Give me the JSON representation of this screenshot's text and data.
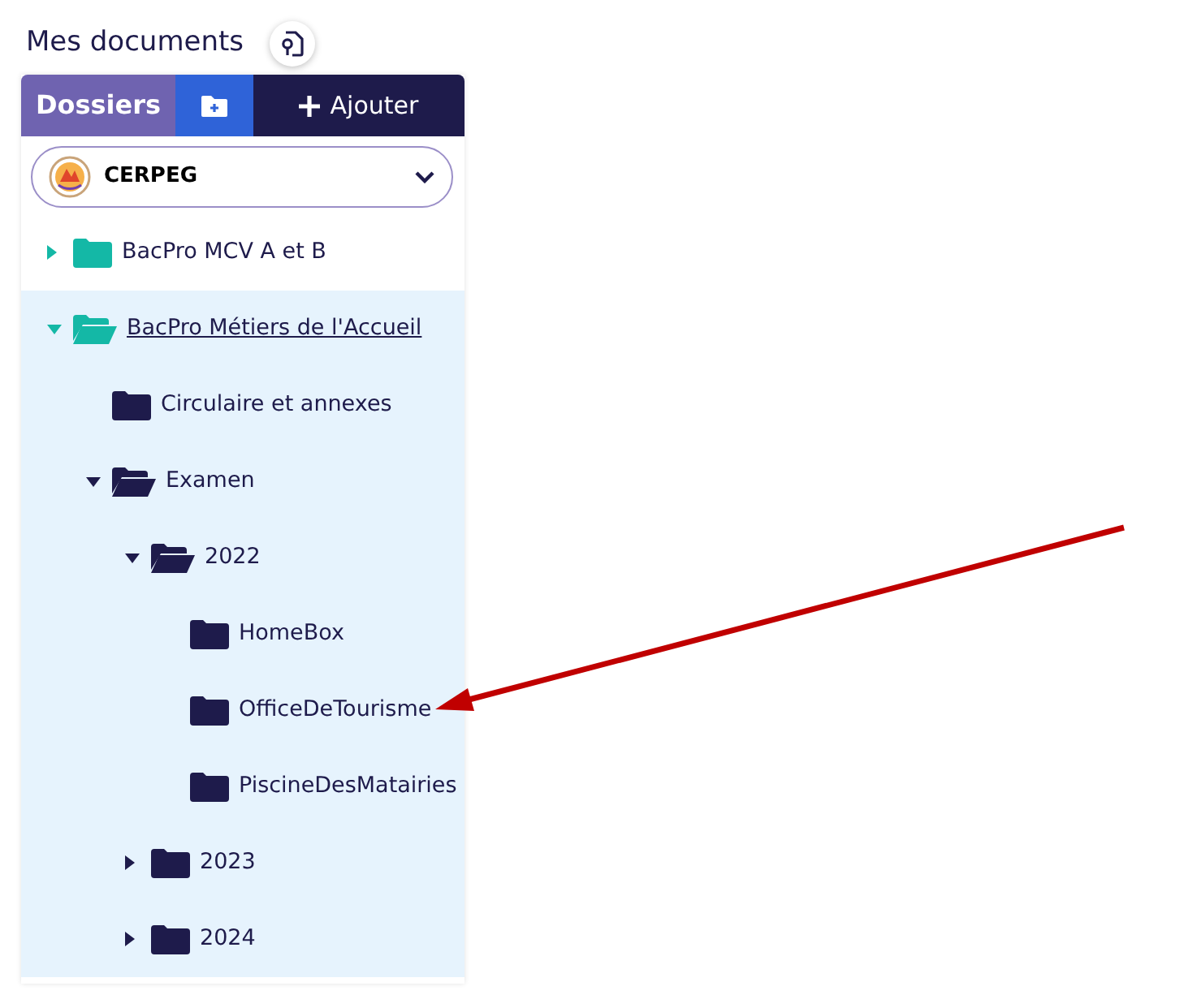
{
  "page_title": "Mes documents",
  "header": {
    "tab": "Dossiers",
    "add_button": "Ajouter"
  },
  "org_select": {
    "value": "CERPEG"
  },
  "tree": [
    {
      "label": "BacPro MCV A et B",
      "expanded": false,
      "selected": false
    },
    {
      "label": "BacPro Métiers de l'Accueil",
      "expanded": true,
      "selected": true,
      "children": [
        {
          "label": "Circulaire et annexes"
        },
        {
          "label": "Examen",
          "expanded": true,
          "children": [
            {
              "label": "2022",
              "expanded": true,
              "children": [
                {
                  "label": "HomeBox"
                },
                {
                  "label": "OfficeDeTourisme"
                },
                {
                  "label": "PiscineDesMatairies"
                }
              ]
            },
            {
              "label": "2023",
              "expanded": false
            },
            {
              "label": "2024",
              "expanded": false
            }
          ]
        }
      ]
    }
  ]
}
